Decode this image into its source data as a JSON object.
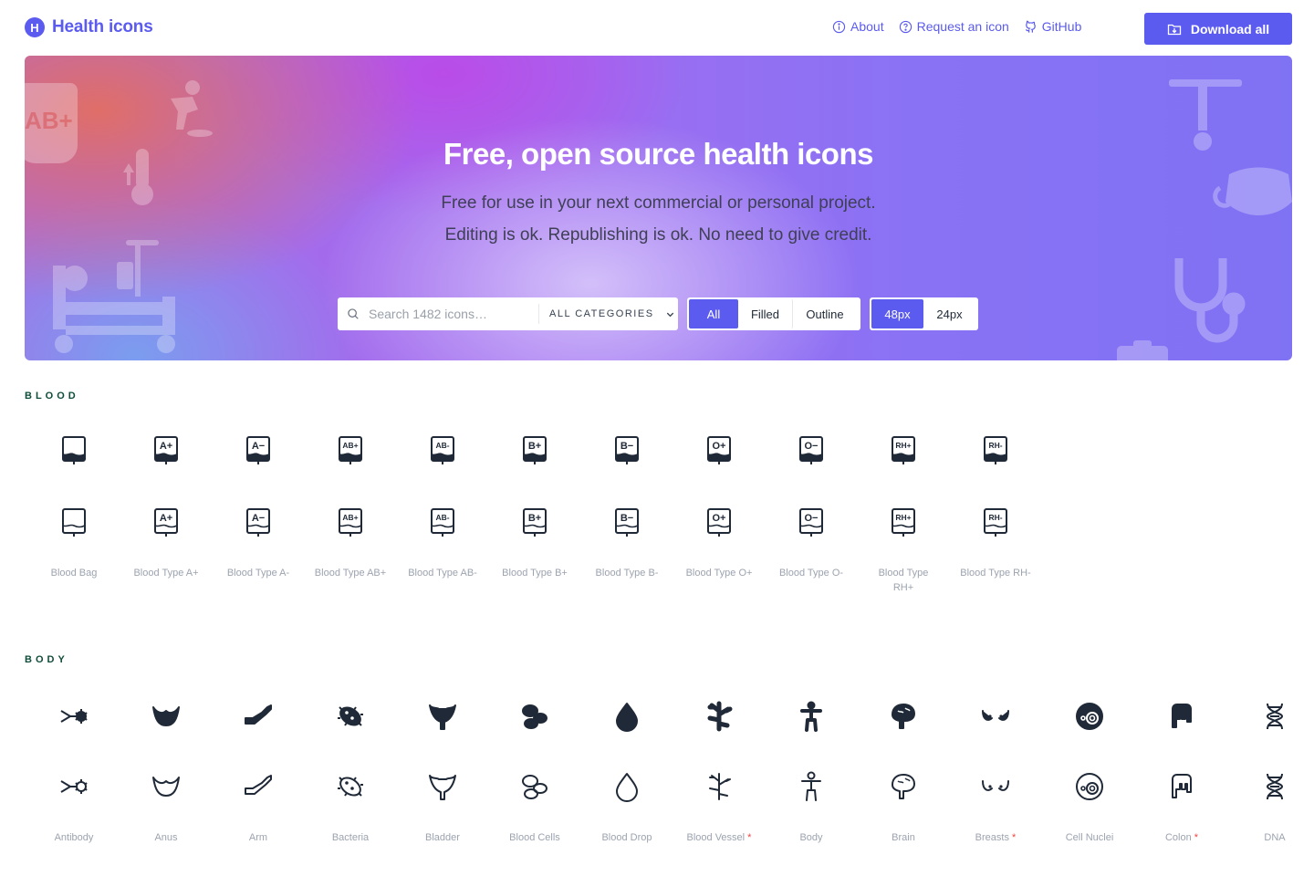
{
  "header": {
    "logo_letter": "H",
    "logo_text": "Health icons",
    "nav": [
      {
        "label": "About",
        "icon": "info-icon"
      },
      {
        "label": "Request an icon",
        "icon": "question-icon"
      },
      {
        "label": "GitHub",
        "icon": "github-icon"
      }
    ],
    "download_label": "Download all"
  },
  "hero": {
    "title": "Free, open source health icons",
    "subtitle_line1": "Free for use in your next commercial or personal project.",
    "subtitle_line2": "Editing is ok. Republishing is ok. No need to give credit.",
    "search_placeholder": "Search 1482 icons…",
    "category_label": "ALL CATEGORIES",
    "style_options": [
      "All",
      "Filled",
      "Outline"
    ],
    "style_selected": "All",
    "size_options": [
      "48px",
      "24px"
    ],
    "size_selected": "48px",
    "accent_color": "#5b5bf0"
  },
  "sections": [
    {
      "title": "BLOOD",
      "icons": [
        {
          "label": "Blood Bag",
          "glyph": "",
          "star": false
        },
        {
          "label": "Blood Type A+",
          "glyph": "A+",
          "star": false
        },
        {
          "label": "Blood Type A-",
          "glyph": "A−",
          "star": false
        },
        {
          "label": "Blood Type AB+",
          "glyph": "AB+",
          "star": false
        },
        {
          "label": "Blood Type AB-",
          "glyph": "AB-",
          "star": false
        },
        {
          "label": "Blood Type B+",
          "glyph": "B+",
          "star": false
        },
        {
          "label": "Blood Type B-",
          "glyph": "B−",
          "star": false
        },
        {
          "label": "Blood Type O+",
          "glyph": "O+",
          "star": false
        },
        {
          "label": "Blood Type O-",
          "glyph": "O−",
          "star": false
        },
        {
          "label": "Blood Type RH+",
          "glyph": "RH+",
          "star": false
        },
        {
          "label": "Blood Type RH-",
          "glyph": "RH-",
          "star": false
        }
      ]
    },
    {
      "title": "BODY",
      "icons": [
        {
          "label": "Antibody",
          "icon": "antibody-icon",
          "star": false
        },
        {
          "label": "Anus",
          "icon": "anus-icon",
          "star": false
        },
        {
          "label": "Arm",
          "icon": "arm-icon",
          "star": false
        },
        {
          "label": "Bacteria",
          "icon": "bacteria-icon",
          "star": false
        },
        {
          "label": "Bladder",
          "icon": "bladder-icon",
          "star": false
        },
        {
          "label": "Blood Cells",
          "icon": "blood-cells-icon",
          "star": false
        },
        {
          "label": "Blood Drop",
          "icon": "blood-drop-icon",
          "star": false
        },
        {
          "label": "Blood Vessel",
          "icon": "blood-vessel-icon",
          "star": true
        },
        {
          "label": "Body",
          "icon": "body-icon",
          "star": false
        },
        {
          "label": "Brain",
          "icon": "brain-icon",
          "star": false
        },
        {
          "label": "Breasts",
          "icon": "breasts-icon",
          "star": true
        },
        {
          "label": "Cell Nuclei",
          "icon": "cell-nuclei-icon",
          "star": false
        },
        {
          "label": "Colon",
          "icon": "colon-icon",
          "star": true
        },
        {
          "label": "DNA",
          "icon": "dna-icon",
          "star": false
        }
      ]
    }
  ]
}
